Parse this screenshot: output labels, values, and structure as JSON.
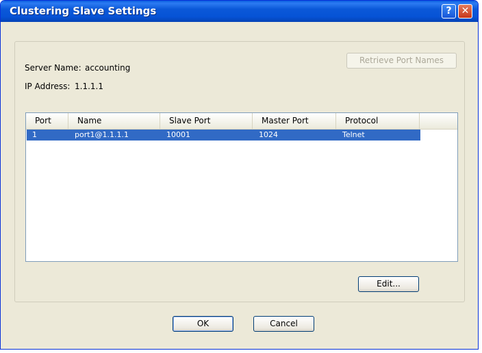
{
  "window": {
    "title": "Clustering Slave Settings"
  },
  "titlebar_buttons": {
    "help": "?",
    "close": "✕"
  },
  "retrieve_button": "Retrieve Port Names",
  "server": {
    "name_label": "Server Name:",
    "name_value": "accounting",
    "ip_label": "IP Address:",
    "ip_value": "1.1.1.1"
  },
  "table": {
    "columns": [
      "Port",
      "Name",
      "Slave Port",
      "Master Port",
      "Protocol"
    ],
    "rows": [
      {
        "port": "1",
        "name": "port1@1.1.1.1",
        "slave_port": "10001",
        "master_port": "1024",
        "protocol": "Telnet",
        "selected": true
      }
    ]
  },
  "edit_button": "Edit...",
  "ok_button": "OK",
  "cancel_button": "Cancel",
  "colors": {
    "titlebar": "#0653d6",
    "dialog": "#ece9d8",
    "selection": "#316ac5"
  }
}
